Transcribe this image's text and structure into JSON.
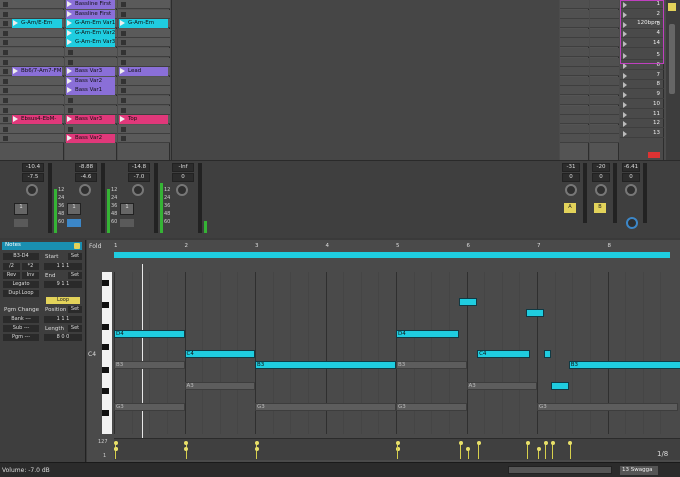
{
  "colors": {
    "cyan": "#1fcde0",
    "purple": "#8a6fd8",
    "pink": "#e0387a",
    "yellow": "#e3d35a",
    "green": "#2ea52e"
  },
  "session": {
    "tracks": [
      {
        "clips": [
          {
            "row": 2,
            "name": "G-Am/E-Em",
            "color": "#1fcde0"
          },
          {
            "row": 7,
            "name": "Bb6/7-Am7-FM",
            "color": "#8a6fd8"
          },
          {
            "row": 12,
            "name": "Ebsus4-EbM-",
            "color": "#e0387a"
          }
        ]
      },
      {
        "clips": [
          {
            "row": 0,
            "name": "Bassline First",
            "color": "#8a6fd8"
          },
          {
            "row": 1,
            "name": "Bassline First",
            "color": "#8a6fd8"
          },
          {
            "row": 2,
            "name": "G-Am-Em Var1",
            "color": "#1fcde0"
          },
          {
            "row": 3,
            "name": "G-Am-Em Var2",
            "color": "#1fcde0"
          },
          {
            "row": 4,
            "name": "G-Am-Em Var3",
            "color": "#1fcde0"
          },
          {
            "row": 7,
            "name": "Bass Var3",
            "color": "#8a6fd8"
          },
          {
            "row": 8,
            "name": "Bass Var2",
            "color": "#8a6fd8"
          },
          {
            "row": 9,
            "name": "Bass Var1",
            "color": "#8a6fd8"
          },
          {
            "row": 12,
            "name": "Bass Var3",
            "color": "#e0387a"
          },
          {
            "row": 14,
            "name": "Bass Var2",
            "color": "#e0387a"
          }
        ]
      },
      {
        "clips": [
          {
            "row": 2,
            "name": "G-Am-Em",
            "color": "#1fcde0"
          },
          {
            "row": 7,
            "name": "Lead",
            "color": "#8a6fd8"
          },
          {
            "row": 12,
            "name": "Top",
            "color": "#e0387a"
          }
        ]
      }
    ],
    "scenes": [
      "1",
      "2",
      "3",
      "4",
      "14",
      "5",
      "6",
      "7",
      "8",
      "9",
      "10",
      "11",
      "12",
      "13"
    ],
    "tempo": "120bpm"
  },
  "mixer": {
    "tracks": [
      {
        "vol": "-10.4",
        "pan": "-7.5",
        "num": "1",
        "sends": "32"
      },
      {
        "vol": "-8.88",
        "pan": "-4.6",
        "num": "1",
        "sends": "32"
      },
      {
        "vol": "-14.8",
        "pan": "-7.0",
        "num": "1",
        "sends": "32"
      },
      {
        "vol": "-Inf",
        "pan": "0",
        "num": "",
        "sends": ""
      }
    ],
    "returns": [
      {
        "vol": "-31",
        "pan": "0",
        "letter": "A"
      },
      {
        "vol": "-20",
        "pan": "0",
        "letter": "B"
      },
      {
        "vol": "-6.41",
        "pan": "0",
        "letter": ""
      }
    ],
    "scale": [
      "12",
      "24",
      "36",
      "48",
      "60"
    ]
  },
  "clip_panel": {
    "title": "Notes",
    "range": "B3-D4",
    "start_lbl": "Start",
    "set_lbl": "Set",
    "div1": "/2",
    "div2": "*2",
    "start_val": "1   1   1",
    "rev": "Rev",
    "inv": "Inv",
    "end_lbl": "End",
    "end_val": "9   1   1",
    "legato": "Legato",
    "dupl": "Dupl.Loop",
    "loop": "Loop",
    "pgm_change": "Pgm Change",
    "position": "Position",
    "pos_val": "1   1   1",
    "bank": "Bank ---",
    "sub": "Sub ---",
    "pgm": "Pgm ---",
    "length": "Length",
    "len_val": "8   0   0"
  },
  "roll": {
    "fold": "Fold",
    "bars": [
      "1",
      "2",
      "3",
      "4",
      "5",
      "6",
      "7",
      "8"
    ],
    "c4_label": "C4",
    "vel_max": "127",
    "vel_min": "1",
    "page": "1/8"
  },
  "notes": [
    {
      "pitch": "D4",
      "start": 0,
      "len": 1.0,
      "on": true
    },
    {
      "pitch": "C4",
      "start": 1,
      "len": 1.0,
      "on": true
    },
    {
      "pitch": "B3",
      "start": 0,
      "len": 1.0,
      "on": false
    },
    {
      "pitch": "B3",
      "start": 2,
      "len": 2.0,
      "on": true
    },
    {
      "pitch": "B3",
      "start": 4,
      "len": 1.0,
      "on": false
    },
    {
      "pitch": "A3",
      "start": 1,
      "len": 1.0,
      "on": false
    },
    {
      "pitch": "G3",
      "start": 0,
      "len": 1.0,
      "on": false
    },
    {
      "pitch": "G3",
      "start": 2,
      "len": 2.0,
      "on": false
    },
    {
      "pitch": "G3",
      "start": 4,
      "len": 1.0,
      "on": false
    },
    {
      "pitch": "D4",
      "start": 4,
      "len": 0.9,
      "on": true
    },
    {
      "pitch": "F4",
      "start": 4.9,
      "len": 0.25,
      "on": true
    },
    {
      "pitch": "E4",
      "start": 5.85,
      "len": 0.25,
      "on": true
    },
    {
      "pitch": "C4",
      "start": 5.15,
      "len": 0.75,
      "on": true
    },
    {
      "pitch": "C4",
      "start": 6.1,
      "len": 0.1,
      "on": true
    },
    {
      "pitch": "B3",
      "start": 6.45,
      "len": 1.6,
      "on": true
    },
    {
      "pitch": "A3",
      "start": 5,
      "len": 1.0,
      "on": false
    },
    {
      "pitch": "A3",
      "start": 6.2,
      "len": 0.25,
      "on": true
    },
    {
      "pitch": "G3",
      "start": 6,
      "len": 2.0,
      "on": false
    }
  ],
  "note_labels": {
    "D4": "D4",
    "C4": "C4",
    "B3": "B3",
    "A3": "A3",
    "G3": "G3",
    "F4": "F4",
    "E4": "E4"
  },
  "status": {
    "left": "Volume: -7.0 dB",
    "right": "13 Swagga"
  }
}
